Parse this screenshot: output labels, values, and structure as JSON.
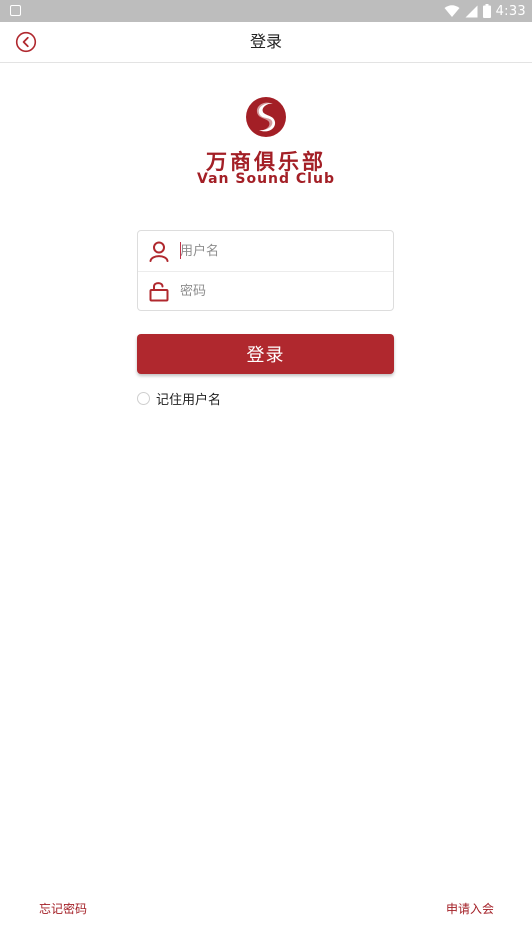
{
  "status_bar": {
    "time": "4:33",
    "icons": [
      "notification-icon",
      "wifi-icon",
      "signal-icon",
      "battery-icon"
    ]
  },
  "header": {
    "title": "登录",
    "back_icon": "back-circle-icon"
  },
  "logo": {
    "name_cn": "万商俱乐部",
    "name_en": "Van Sound Club"
  },
  "form": {
    "username": {
      "placeholder": "用户名",
      "value": "",
      "icon": "user-icon"
    },
    "password": {
      "placeholder": "密码",
      "value": "",
      "icon": "lock-icon"
    },
    "login_label": "登录",
    "remember_label": "记住用户名",
    "remember_checked": false
  },
  "footer": {
    "forgot_password": "忘记密码",
    "apply_membership": "申请入会"
  },
  "colors": {
    "accent": "#b0282e",
    "status_bar": "#bdbdbd"
  }
}
